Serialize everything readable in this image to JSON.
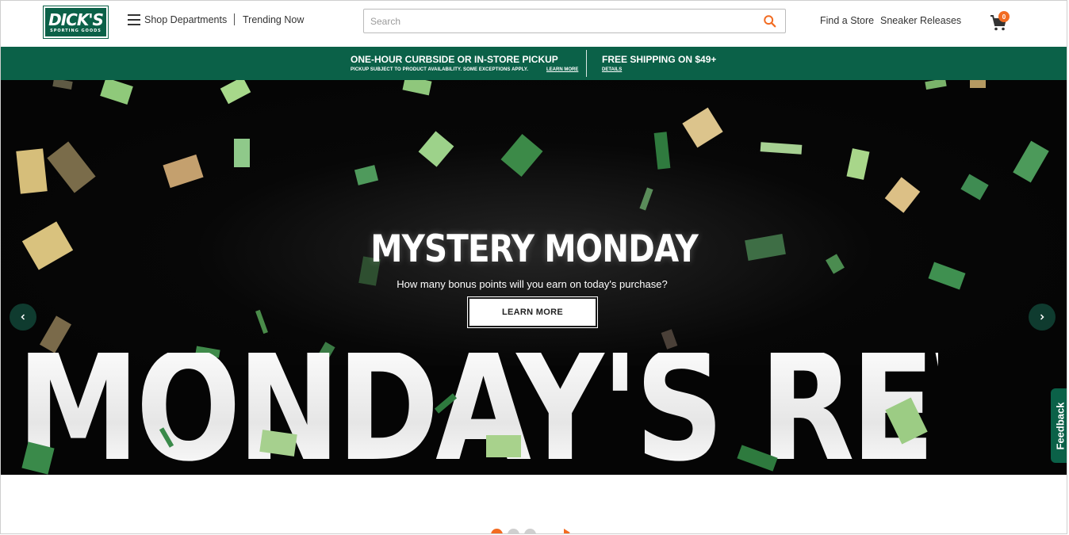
{
  "header": {
    "logo_main": "DICK'S",
    "logo_sub": "SPORTING GOODS",
    "shop_departments": "Shop Departments",
    "trending_now": "Trending Now",
    "search_placeholder": "Search",
    "find_store": "Find a Store",
    "sneaker_releases": "Sneaker Releases",
    "cart_count": "0"
  },
  "promo": {
    "left_title": "ONE-HOUR CURBSIDE OR IN-STORE PICKUP",
    "left_sub": "PICKUP SUBJECT TO PRODUCT AVAILABILITY. SOME EXCEPTIONS APPLY.",
    "left_link": "LEARN MORE",
    "right_title": "FREE SHIPPING ON $49+",
    "right_link": "DETAILS"
  },
  "hero": {
    "title": "MYSTERY MONDAY",
    "subtitle": "How many bonus points will you earn on today's purchase?",
    "button": "LEARN MORE",
    "big_text": "MONDAY'S REWARD"
  },
  "feedback": "Feedback",
  "carousel": {
    "slides": 3,
    "active": 0
  },
  "colors": {
    "brand_green": "#0b6148",
    "accent_orange": "#f26b21",
    "hero_bg": "#050505"
  },
  "icons": [
    "menu-icon",
    "search-icon",
    "cart-icon",
    "chevron-left-icon",
    "chevron-right-icon"
  ]
}
